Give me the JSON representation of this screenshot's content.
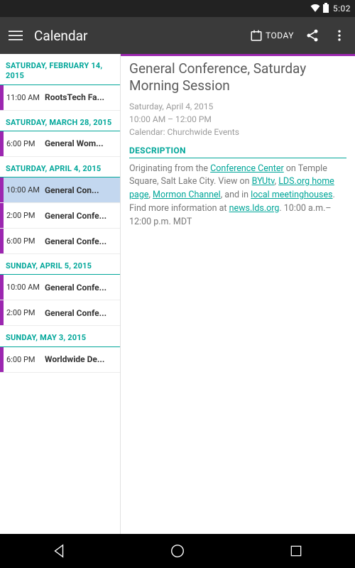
{
  "status": {
    "time": "5:02"
  },
  "appbar": {
    "title": "Calendar",
    "today": "TODAY"
  },
  "groups": [
    {
      "header": "SATURDAY, FEBRUARY 14, 2015",
      "events": [
        {
          "time": "11:00 AM",
          "name": "RootsTech Fa..."
        }
      ]
    },
    {
      "header": "SATURDAY, MARCH 28, 2015",
      "events": [
        {
          "time": "6:00 PM",
          "name": "General Wom..."
        }
      ]
    },
    {
      "header": "SATURDAY, APRIL 4, 2015",
      "events": [
        {
          "time": "10:00 AM",
          "name": "General Con...",
          "selected": true
        },
        {
          "time": "2:00 PM",
          "name": "General Confe..."
        },
        {
          "time": "6:00 PM",
          "name": "General Confe..."
        }
      ]
    },
    {
      "header": "SUNDAY, APRIL 5, 2015",
      "events": [
        {
          "time": "10:00 AM",
          "name": "General Confe..."
        },
        {
          "time": "2:00 PM",
          "name": "General Confe..."
        }
      ]
    },
    {
      "header": "SUNDAY, MAY 3, 2015",
      "events": [
        {
          "time": "6:00 PM",
          "name": "Worldwide De..."
        }
      ]
    }
  ],
  "detail": {
    "title": "General Conference, Saturday Morning Session",
    "date": "Saturday, April 4, 2015",
    "time": "10:00 AM – 12:00 PM",
    "calendar": "Calendar: Churchwide Events",
    "descLabel": "DESCRIPTION",
    "desc": {
      "p1a": "Originating from the ",
      "l1": "Conference Center",
      "p1b": " on Temple Square, Salt Lake City. View on ",
      "l2": "BYUtv",
      "p1c": ", ",
      "l3": "LDS.org home page",
      "p1d": ", ",
      "l4": "Mormon Channel",
      "p1e": ", and in ",
      "l5": "local meetinghouses",
      "p1f": ". Find more information at ",
      "l6": "news.lds.org",
      "p1g": ". 10:00 a.m.–12:00 p.m. MDT"
    }
  }
}
